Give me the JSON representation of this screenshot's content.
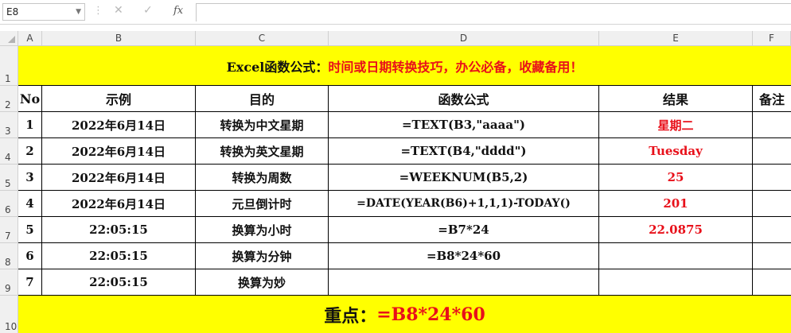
{
  "formula_bar": {
    "name_box": "E8",
    "fx_label": "fx"
  },
  "columns": [
    "A",
    "B",
    "C",
    "D",
    "E",
    "F"
  ],
  "rows": [
    "1",
    "2",
    "3",
    "4",
    "5",
    "6",
    "7",
    "8",
    "9",
    "10"
  ],
  "title": {
    "prefix": "Excel函数公式：",
    "rest": "时间或日期转换技巧，办公必备，收藏备用！"
  },
  "headers": {
    "no": "No",
    "example": "示例",
    "purpose": "目的",
    "formula": "函数公式",
    "result": "结果",
    "note": "备注"
  },
  "table": [
    {
      "no": "1",
      "example": "2022年6月14日",
      "purpose": "转换为中文星期",
      "formula": "=TEXT(B3,\"aaaa\")",
      "result": "星期二"
    },
    {
      "no": "2",
      "example": "2022年6月14日",
      "purpose": "转换为英文星期",
      "formula": "=TEXT(B4,\"dddd\")",
      "result": "Tuesday"
    },
    {
      "no": "3",
      "example": "2022年6月14日",
      "purpose": "转换为周数",
      "formula": "=WEEKNUM(B5,2)",
      "result": "25"
    },
    {
      "no": "4",
      "example": "2022年6月14日",
      "purpose": "元旦倒计时",
      "formula": "=DATE(YEAR(B6)+1,1,1)-TODAY()",
      "result": "201"
    },
    {
      "no": "5",
      "example": "22:05:15",
      "purpose": "换算为小时",
      "formula": "=B7*24",
      "result": "22.0875"
    },
    {
      "no": "6",
      "example": "22:05:15",
      "purpose": "换算为分钟",
      "formula": "=B8*24*60",
      "result": ""
    },
    {
      "no": "7",
      "example": "22:05:15",
      "purpose": "换算为妙",
      "formula": "",
      "result": ""
    }
  ],
  "footer": {
    "prefix": "重点：",
    "formula": "=B8*24*60"
  },
  "colors": {
    "banner": "#ffff00",
    "accent_red": "#e8101a"
  }
}
